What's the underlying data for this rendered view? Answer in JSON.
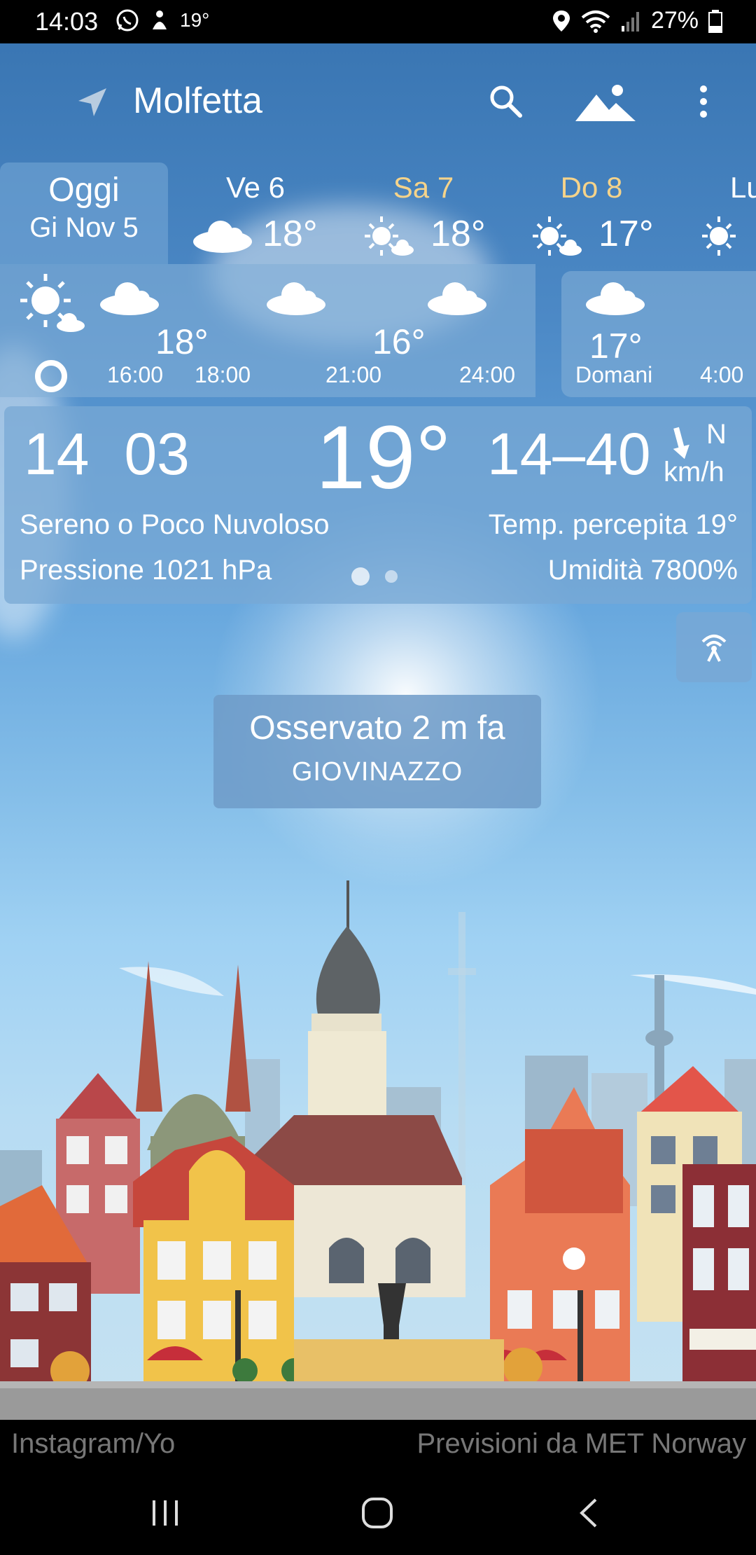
{
  "status_bar": {
    "time": "14:03",
    "temp": "19°",
    "battery": "27%",
    "icons": [
      "whatsapp-icon",
      "notification-icon",
      "location-icon",
      "wifi-icon",
      "signal-icon",
      "battery-icon"
    ]
  },
  "app_bar": {
    "city": "Molfetta",
    "icons": [
      "location-arrow-icon",
      "search-icon",
      "landscape-icon",
      "more-icon"
    ]
  },
  "days": {
    "today": {
      "label": "Oggi",
      "date": "Gi Nov 5"
    },
    "items": [
      {
        "name": "Ve 6",
        "temp": "18°",
        "icon": "cloud-icon",
        "weekend": false
      },
      {
        "name": "Sa 7",
        "temp": "18°",
        "icon": "sun-cloud-icon",
        "weekend": true
      },
      {
        "name": "Do 8",
        "temp": "17°",
        "icon": "sun-cloud-icon",
        "weekend": true
      },
      {
        "name": "Lu",
        "temp": "",
        "icon": "sun-icon",
        "weekend": false
      }
    ]
  },
  "hourly": {
    "temps": [
      "18°",
      "16°",
      "17°"
    ],
    "times": [
      "16:00",
      "18:00",
      "21:00",
      "24:00",
      "Domani",
      "4:00"
    ]
  },
  "current": {
    "time_h": "14",
    "time_m": "03",
    "temp": "19°",
    "wind_speed": "14–40",
    "wind_dir": "N",
    "wind_unit": "km/h",
    "description": "Sereno o Poco Nuvoloso",
    "pressure": "Pressione 1021 hPa",
    "feels_like": "Temp. percepita 19°",
    "humidity": "Umidità 7800%"
  },
  "observed": {
    "line1": "Osservato 2 m fa",
    "station": "GIOVINAZZO"
  },
  "credits": {
    "left": "Instagram/Yo",
    "right": "Previsioni da MET Norway"
  },
  "colors": {
    "weekend": "#f5d38a",
    "panel": "#78a8d4",
    "sky_top": "#3a76b3"
  }
}
